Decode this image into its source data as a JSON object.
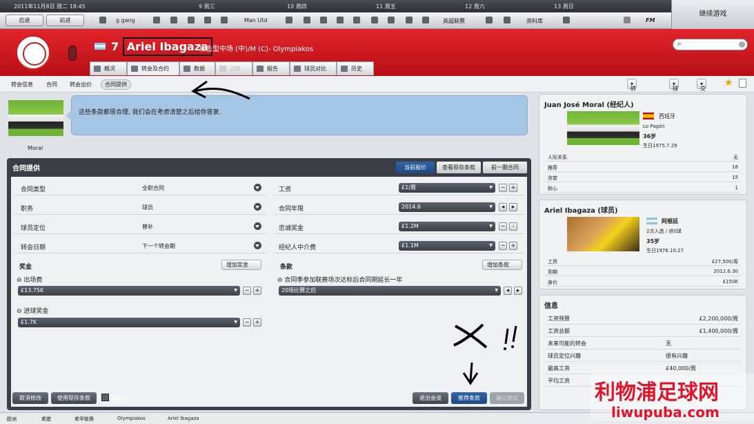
{
  "topbar": {
    "date": "2011年11月8日 周二 18:45",
    "days": [
      "9 周三",
      "10 周四",
      "11 周五",
      "12 周六",
      "13 周日"
    ]
  },
  "nav": {
    "back": "后退",
    "forward": "前进",
    "manager": "g gang",
    "club": "Man Utd",
    "league": "英超联赛",
    "database": "资料库",
    "fm": "FM"
  },
  "continue_button": "继续游戏",
  "player": {
    "number": "7",
    "name": "Ariel Ibagaza",
    "description": "攻击型中场 (中)/M (C)- Olympiakos"
  },
  "tabs": [
    "概况",
    "转会及合约",
    "数据",
    "训练",
    "报告",
    "球员对比",
    "历史"
  ],
  "subnav": {
    "items": [
      "转会信息",
      "合同",
      "转会出价",
      "合同提供"
    ],
    "right": [
      "转会&合同",
      "球探",
      "交流"
    ]
  },
  "agent_message": "这些条款都很合理, 我们会在考虑清楚之后给你答复.",
  "agent_caption": "Moral",
  "contract": {
    "title": "合同提供",
    "view_tabs": [
      "当前报价",
      "查看现存条款",
      "前一期合同"
    ],
    "left_rows": [
      {
        "label": "合同类型",
        "value": "全职合同"
      },
      {
        "label": "职务",
        "value": "球员"
      },
      {
        "label": "球员定位",
        "value": "替补"
      },
      {
        "label": "转会日期",
        "value": "下一个转会期"
      }
    ],
    "right_rows": [
      {
        "label": "工资",
        "value": "£1/周"
      },
      {
        "label": "合同年限",
        "value": "2014.6"
      },
      {
        "label": "忠诚奖金",
        "value": "£1.2M"
      },
      {
        "label": "经纪人中介费",
        "value": "£1.1M"
      }
    ],
    "bonus_title": "奖金",
    "add_bonus": "增加奖金",
    "bonuses": [
      {
        "label": "出场费",
        "value": "£13.75K"
      },
      {
        "label": "进球奖金",
        "value": "£1.7K"
      }
    ],
    "clauses_title": "条款",
    "add_clause": "增加条款",
    "clause": {
      "label": "合同季参加联赛场次达标后合同期延长一年",
      "value": "20场比赛之后"
    },
    "buttons": {
      "cancel": "取消修改",
      "use_existing": "使用现存条款",
      "unofficial": "非面议",
      "leave": "退出会谈",
      "propose": "推荐条款",
      "confirm": "确认协议"
    }
  },
  "agent_card": {
    "title": "Juan José Moral (经纪人)",
    "nation": "西班牙",
    "club": "Lo Pagán",
    "age": "36岁",
    "born": "生日1975.7.29",
    "rows": [
      {
        "k": "人际关系",
        "v": "无"
      },
      {
        "k": "推荐",
        "v": "16"
      },
      {
        "k": "贪婪",
        "v": "15"
      },
      {
        "k": "耐心",
        "v": "1"
      }
    ]
  },
  "player_card": {
    "title": "Ariel Ibagaza (球员)",
    "nation": "阿根廷",
    "caps": "2次入选 / 进0球",
    "age": "35岁",
    "born": "生日1976.10.27",
    "rows": [
      {
        "k": "工资",
        "v": "£27,500/周"
      },
      {
        "k": "到期",
        "v": "2012.6.30"
      },
      {
        "k": "身价",
        "v": "£150K"
      }
    ]
  },
  "info_card": {
    "title": "信息",
    "rows": [
      {
        "k": "工资预算",
        "v": "£2,200,000/周"
      },
      {
        "k": "工资总额",
        "v": "£1,400,000/周"
      },
      {
        "k": "未来可能的转会",
        "v": "无"
      },
      {
        "k": "球员定位兴趣",
        "v": "很有兴趣"
      },
      {
        "k": "最高工资",
        "v": "£40,000/周"
      },
      {
        "k": "平均工资",
        "v": ""
      }
    ]
  },
  "statusbar": [
    "欧洲",
    "希腊",
    "希甲联赛",
    "Olympiakos",
    "Ariel Ibagaza"
  ],
  "watermark": {
    "cn": "利物浦足球网",
    "url": "liwupuba.com"
  },
  "colors": {
    "header_red": "#d21c22",
    "accent_blue": "#2f63a8",
    "bubble": "#a6c6e6"
  }
}
